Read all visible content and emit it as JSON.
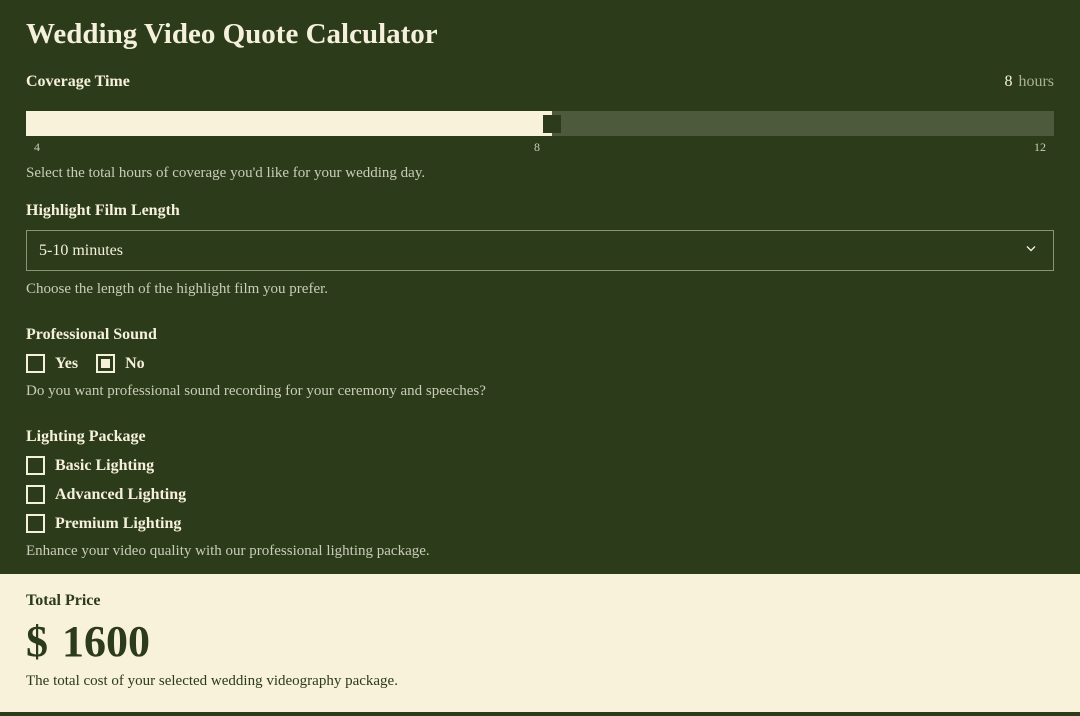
{
  "title": "Wedding Video Quote Calculator",
  "coverage": {
    "label": "Coverage Time",
    "value": "8",
    "unit": "hours",
    "ticks": {
      "min": "4",
      "mid": "8",
      "max": "12"
    },
    "helper": "Select the total hours of coverage you'd like for your wedding day."
  },
  "highlight": {
    "label": "Highlight Film Length",
    "selected": "5-10 minutes",
    "helper": "Choose the length of the highlight film you prefer."
  },
  "sound": {
    "label": "Professional Sound",
    "options": {
      "yes": "Yes",
      "no": "No"
    },
    "selected": "no",
    "helper": "Do you want professional sound recording for your ceremony and speeches?"
  },
  "lighting": {
    "label": "Lighting Package",
    "options": {
      "basic": "Basic Lighting",
      "advanced": "Advanced Lighting",
      "premium": "Premium Lighting"
    },
    "helper": "Enhance your video quality with our professional lighting package."
  },
  "total": {
    "label": "Total Price",
    "currency": "$",
    "amount": "1600",
    "helper": "The total cost of your selected wedding videography package."
  }
}
